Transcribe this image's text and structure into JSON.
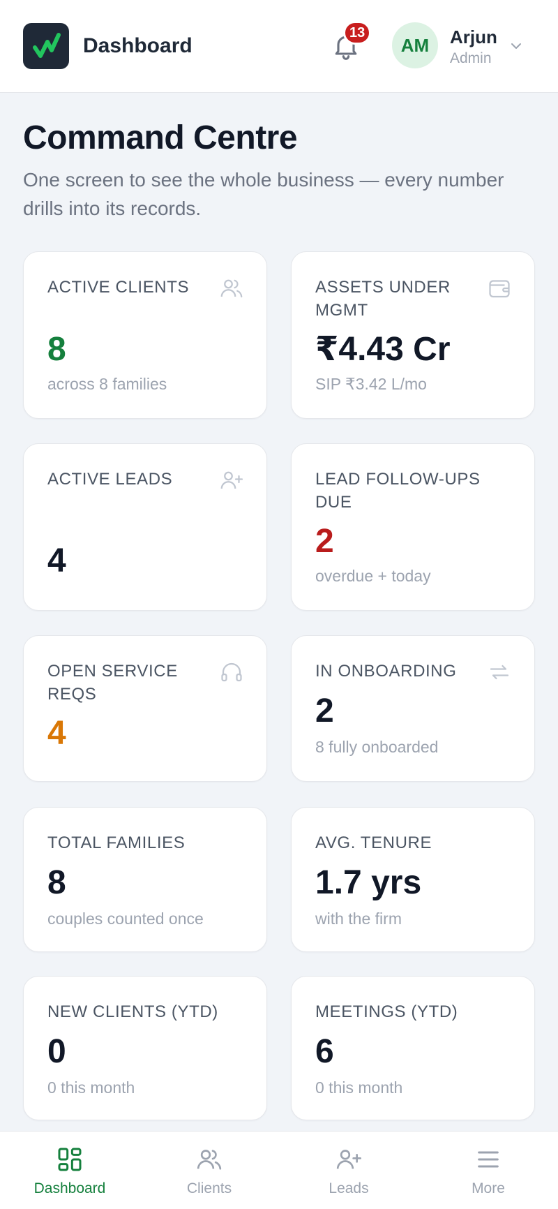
{
  "header": {
    "app_title": "Dashboard",
    "notification_count": "13",
    "user_initials": "AM",
    "user_name": "Arjun",
    "user_role": "Admin"
  },
  "page": {
    "title": "Command Centre",
    "subtitle": "One screen to see the whole business — every number drills into its records."
  },
  "cards": [
    {
      "label": "ACTIVE CLIENTS",
      "value": "8",
      "sub": "across 8 families",
      "icon": "users-icon",
      "value_color": "#15803d"
    },
    {
      "label": "ASSETS UNDER MGMT",
      "value": "₹4.43 Cr",
      "sub": "SIP ₹3.42 L/mo",
      "icon": "wallet-icon",
      "value_color": "#111827"
    },
    {
      "label": "ACTIVE LEADS",
      "value": "4",
      "sub": "",
      "icon": "user-plus-icon",
      "value_color": "#111827"
    },
    {
      "label": "LEAD FOLLOW-UPS DUE",
      "value": "2",
      "sub": "overdue + today",
      "icon": "",
      "value_color": "#b91c1c"
    },
    {
      "label": "OPEN SERVICE REQS",
      "value": "4",
      "sub": "",
      "icon": "headphones-icon",
      "value_color": "#d97706"
    },
    {
      "label": "IN ONBOARDING",
      "value": "2",
      "sub": "8 fully onboarded",
      "icon": "repeat-icon",
      "value_color": "#111827"
    },
    {
      "label": "TOTAL FAMILIES",
      "value": "8",
      "sub": "couples counted once",
      "icon": "",
      "value_color": "#111827"
    },
    {
      "label": "AVG. TENURE",
      "value": "1.7 yrs",
      "sub": "with the firm",
      "icon": "",
      "value_color": "#111827"
    },
    {
      "label": "NEW CLIENTS (YTD)",
      "value": "0",
      "sub": "0 this month",
      "icon": "",
      "value_color": "#111827"
    },
    {
      "label": "MEETINGS (YTD)",
      "value": "6",
      "sub": "0 this month",
      "icon": "",
      "value_color": "#111827"
    }
  ],
  "nav": [
    {
      "label": "Dashboard",
      "icon": "grid-icon",
      "active": true
    },
    {
      "label": "Clients",
      "icon": "users-icon",
      "active": false
    },
    {
      "label": "Leads",
      "icon": "user-plus-icon",
      "active": false
    },
    {
      "label": "More",
      "icon": "menu-icon",
      "active": false
    }
  ],
  "colors": {
    "accent": "#15803d",
    "danger": "#c81e1e",
    "warning": "#d97706"
  }
}
